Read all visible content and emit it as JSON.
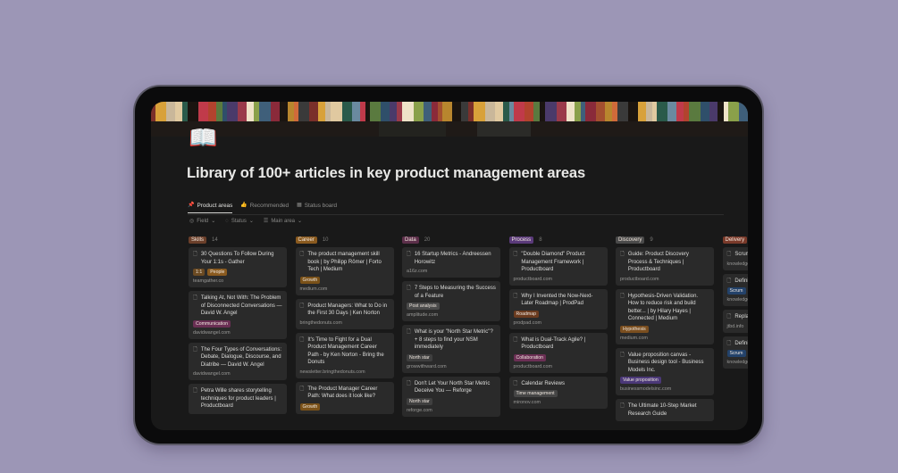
{
  "page": {
    "icon": "open-book-icon",
    "title": "Library of 100+ articles in key product management areas"
  },
  "tabs": [
    {
      "label": "Product areas",
      "icon": "pin-icon"
    },
    {
      "label": "Recommended",
      "icon": "thumbs-up-icon"
    },
    {
      "label": "Status board",
      "icon": "board-icon"
    }
  ],
  "filters": [
    {
      "label": "Field",
      "icon": "circle-icon"
    },
    {
      "label": "Status",
      "icon": "status-icon"
    },
    {
      "label": "Main area",
      "icon": "list-icon"
    }
  ],
  "colors": {
    "Skills": "#6b3f2a",
    "Career": "#8a5a1f",
    "Data": "#5c2f4a",
    "Process": "#5a3a7a",
    "Discovery": "#4a4a4a",
    "Delivery": "#7a3a2a",
    "People": "#8a5a1f",
    "1:1": "#6b4a22",
    "Growth": "#7a5118",
    "Communication": "#6a2f54",
    "Post analysis": "#4a4a4a",
    "North star": "#3f3f3f",
    "Roadmap": "#6b3b1f",
    "Collaboration": "#6b2f54",
    "Time management": "#454545",
    "Hypothesis": "#7a4e1f",
    "Value proposition": "#4b3878",
    "Scrum": "#23426a"
  },
  "columns": [
    {
      "name": "Skills",
      "count": "14",
      "cards": [
        {
          "title": "30 Questions To Follow During Your 1:1s - Gather",
          "tags": [
            "1:1",
            "People"
          ],
          "source": "teamgather.co"
        },
        {
          "title": "Talking At, Not With: The Problem of Disconnected Conversations — David W. Angel",
          "tags": [
            "Communication"
          ],
          "source": "davidwangel.com"
        },
        {
          "title": "The Four Types of Conversations: Debate, Dialogue, Discourse, and Diatribe — David W. Angel",
          "tags": [],
          "source": "davidwangel.com"
        },
        {
          "title": "Petra Wille shares storytelling techniques for product leaders | Productboard",
          "tags": [],
          "source": ""
        }
      ]
    },
    {
      "name": "Career",
      "count": "10",
      "cards": [
        {
          "title": "The product management skill book | by Philipp Römer | Forto Tech | Medium",
          "tags": [
            "Growth"
          ],
          "source": "medium.com"
        },
        {
          "title": "Product Managers: What to Do in the First 30 Days | Ken Norton",
          "tags": [],
          "source": "bringthedonuts.com"
        },
        {
          "title": "It's Time to Fight for a Dual Product Management Career Path - by Ken Norton - Bring the Donuts",
          "tags": [],
          "source": "newsletter.bringthedonuts.com"
        },
        {
          "title": "The Product Manager Career Path: What does it look like?",
          "tags": [
            "Growth"
          ],
          "source": ""
        }
      ]
    },
    {
      "name": "Data",
      "count": "20",
      "cards": [
        {
          "title": "16 Startup Metrics - Andreessen Horowitz",
          "tags": [],
          "source": "a16z.com"
        },
        {
          "title": "7 Steps to Measuring the Success of a Feature",
          "tags": [
            "Post analysis"
          ],
          "source": "amplitude.com"
        },
        {
          "title": "What is your \"North Star Metric\"? + 8 steps to find your NSM immediately",
          "tags": [
            "North star"
          ],
          "source": "growwithward.com"
        },
        {
          "title": "Don't Let Your North Star Metric Deceive You — Reforge",
          "tags": [
            "North star"
          ],
          "source": "reforge.com"
        }
      ]
    },
    {
      "name": "Process",
      "count": "8",
      "cards": [
        {
          "title": "\"Double Diamond\" Product Management Framework | Productboard",
          "tags": [],
          "source": "productboard.com"
        },
        {
          "title": "Why I Invented the Now-Next-Later Roadmap | ProdPad",
          "tags": [
            "Roadmap"
          ],
          "source": "prodpad.com"
        },
        {
          "title": "What is Dual-Track Agile? | Productboard",
          "tags": [
            "Collaboration"
          ],
          "source": "productboard.com"
        },
        {
          "title": "Calendar Reviews",
          "tags": [
            "Time management"
          ],
          "source": "mironov.com"
        }
      ]
    },
    {
      "name": "Discovery",
      "count": "9",
      "cards": [
        {
          "title": "Guide: Product Discovery Process & Techniques | Productboard",
          "tags": [],
          "source": "productboard.com"
        },
        {
          "title": "Hypothesis-Driven Validation. How to reduce risk and build better... | by Hilary Hayes | Connected | Medium",
          "tags": [
            "Hypothesis"
          ],
          "source": "medium.com"
        },
        {
          "title": "Value proposition canvas - Business design tool - Business Models Inc.",
          "tags": [
            "Value proposition"
          ],
          "source": "businessmodelsinc.com"
        },
        {
          "title": "The Ultimate 10-Step Market Research Guide",
          "tags": [],
          "source": ""
        }
      ]
    },
    {
      "name": "Delivery",
      "count": "",
      "cards": [
        {
          "title": "Scrum [Every",
          "tags": [],
          "source": "knowledget"
        },
        {
          "title": "Definit Steps",
          "tags": [
            "Scrum"
          ],
          "source": "knowledget"
        },
        {
          "title": "Replac The Jo | Jobs",
          "tags": [],
          "source": "jtbd.info"
        },
        {
          "title": "Definit Everyt Examp",
          "tags": [
            "Scrum"
          ],
          "source": "knowledget"
        }
      ]
    }
  ]
}
